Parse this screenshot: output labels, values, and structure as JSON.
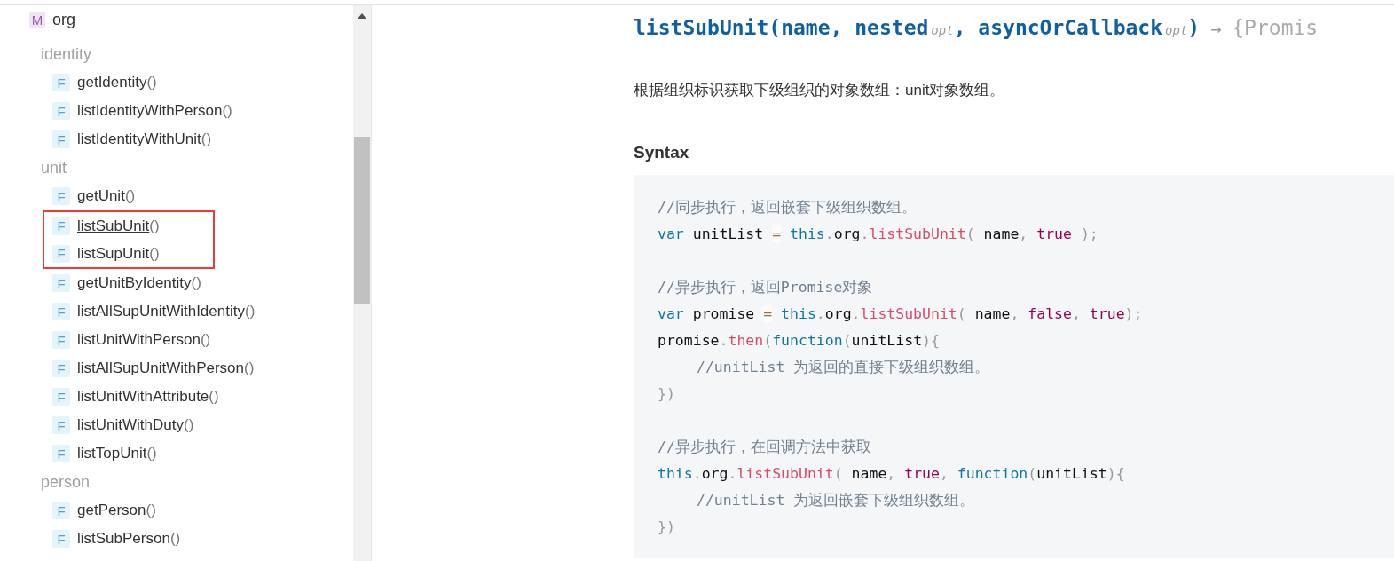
{
  "sidebar": {
    "module": {
      "badge": "M",
      "name": "org"
    },
    "groups": [
      {
        "title": "identity",
        "items": [
          {
            "badge": "F",
            "label": "getIdentity",
            "parens": "()",
            "hovered": false,
            "highlighted": false
          },
          {
            "badge": "F",
            "label": "listIdentityWithPerson",
            "parens": "()",
            "hovered": false,
            "highlighted": false
          },
          {
            "badge": "F",
            "label": "listIdentityWithUnit",
            "parens": "()",
            "hovered": false,
            "highlighted": false
          }
        ]
      },
      {
        "title": "unit",
        "items": [
          {
            "badge": "F",
            "label": "getUnit",
            "parens": "()",
            "hovered": false,
            "highlighted": false
          },
          {
            "badge": "F",
            "label": "listSubUnit",
            "parens": "()",
            "hovered": true,
            "highlighted": true
          },
          {
            "badge": "F",
            "label": "listSupUnit",
            "parens": "()",
            "hovered": false,
            "highlighted": true
          },
          {
            "badge": "F",
            "label": "getUnitByIdentity",
            "parens": "()",
            "hovered": false,
            "highlighted": false
          },
          {
            "badge": "F",
            "label": "listAllSupUnitWithIdentity",
            "parens": "()",
            "hovered": false,
            "highlighted": false
          },
          {
            "badge": "F",
            "label": "listUnitWithPerson",
            "parens": "()",
            "hovered": false,
            "highlighted": false
          },
          {
            "badge": "F",
            "label": "listAllSupUnitWithPerson",
            "parens": "()",
            "hovered": false,
            "highlighted": false
          },
          {
            "badge": "F",
            "label": "listUnitWithAttribute",
            "parens": "()",
            "hovered": false,
            "highlighted": false
          },
          {
            "badge": "F",
            "label": "listUnitWithDuty",
            "parens": "()",
            "hovered": false,
            "highlighted": false
          },
          {
            "badge": "F",
            "label": "listTopUnit",
            "parens": "()",
            "hovered": false,
            "highlighted": false
          }
        ]
      },
      {
        "title": "person",
        "items": [
          {
            "badge": "F",
            "label": "getPerson",
            "parens": "()",
            "hovered": false,
            "highlighted": false
          },
          {
            "badge": "F",
            "label": "listSubPerson",
            "parens": "()",
            "hovered": false,
            "highlighted": false
          }
        ]
      }
    ]
  },
  "doc": {
    "signature": [
      {
        "kind": "name",
        "text": "listSubUnit(name, nested"
      },
      {
        "kind": "opt",
        "text": "opt"
      },
      {
        "kind": "name",
        "text": ", asyncOrCallback"
      },
      {
        "kind": "opt",
        "text": "opt"
      },
      {
        "kind": "name",
        "text": ")"
      },
      {
        "kind": "arrow",
        "text": "→"
      },
      {
        "kind": "type",
        "text": "{Promis"
      }
    ],
    "description": "根据组织标识获取下级组织的对象数组：unit对象数组。",
    "syntax_heading": "Syntax",
    "code": [
      {
        "kind": "code",
        "indented": false,
        "tokens": [
          {
            "kind": "comment",
            "text": "//同步执行，返回嵌套下级组织数组。"
          }
        ]
      },
      {
        "kind": "code",
        "indented": false,
        "tokens": [
          {
            "kind": "keyword",
            "text": "var"
          },
          {
            "kind": "plain",
            "text": " unitList "
          },
          {
            "kind": "op",
            "text": "="
          },
          {
            "kind": "keyword",
            "text": " this"
          },
          {
            "kind": "punct",
            "text": "."
          },
          {
            "kind": "plain",
            "text": "org"
          },
          {
            "kind": "punct",
            "text": "."
          },
          {
            "kind": "fn",
            "text": "listSubUnit"
          },
          {
            "kind": "punct",
            "text": "("
          },
          {
            "kind": "plain",
            "text": " name"
          },
          {
            "kind": "punct",
            "text": ","
          },
          {
            "kind": "bool",
            "text": " true"
          },
          {
            "kind": "punct",
            "text": " );"
          }
        ]
      },
      {
        "kind": "blank"
      },
      {
        "kind": "code",
        "indented": false,
        "tokens": [
          {
            "kind": "comment",
            "text": "//异步执行，返回Promise对象"
          }
        ]
      },
      {
        "kind": "code",
        "indented": false,
        "tokens": [
          {
            "kind": "keyword",
            "text": "var"
          },
          {
            "kind": "plain",
            "text": " promise "
          },
          {
            "kind": "op",
            "text": "="
          },
          {
            "kind": "keyword",
            "text": " this"
          },
          {
            "kind": "punct",
            "text": "."
          },
          {
            "kind": "plain",
            "text": "org"
          },
          {
            "kind": "punct",
            "text": "."
          },
          {
            "kind": "fn",
            "text": "listSubUnit"
          },
          {
            "kind": "punct",
            "text": "("
          },
          {
            "kind": "plain",
            "text": " name"
          },
          {
            "kind": "punct",
            "text": ","
          },
          {
            "kind": "bool",
            "text": " false"
          },
          {
            "kind": "punct",
            "text": ","
          },
          {
            "kind": "bool",
            "text": " true"
          },
          {
            "kind": "punct",
            "text": ");"
          }
        ]
      },
      {
        "kind": "code",
        "indented": false,
        "tokens": [
          {
            "kind": "plain",
            "text": "promise"
          },
          {
            "kind": "punct",
            "text": "."
          },
          {
            "kind": "fn",
            "text": "then"
          },
          {
            "kind": "punct",
            "text": "("
          },
          {
            "kind": "keyword",
            "text": "function"
          },
          {
            "kind": "punct",
            "text": "("
          },
          {
            "kind": "plain",
            "text": "unitList"
          },
          {
            "kind": "punct",
            "text": "){"
          }
        ]
      },
      {
        "kind": "code",
        "indented": true,
        "tokens": [
          {
            "kind": "comment",
            "text": "//unitList 为返回的直接下级组织数组。"
          }
        ]
      },
      {
        "kind": "code",
        "indented": false,
        "tokens": [
          {
            "kind": "punct",
            "text": "})"
          }
        ]
      },
      {
        "kind": "blank"
      },
      {
        "kind": "code",
        "indented": false,
        "tokens": [
          {
            "kind": "comment",
            "text": "//异步执行，在回调方法中获取"
          }
        ]
      },
      {
        "kind": "code",
        "indented": false,
        "tokens": [
          {
            "kind": "keyword",
            "text": "this"
          },
          {
            "kind": "punct",
            "text": "."
          },
          {
            "kind": "plain",
            "text": "org"
          },
          {
            "kind": "punct",
            "text": "."
          },
          {
            "kind": "fn",
            "text": "listSubUnit"
          },
          {
            "kind": "punct",
            "text": "("
          },
          {
            "kind": "plain",
            "text": " name"
          },
          {
            "kind": "punct",
            "text": ","
          },
          {
            "kind": "bool",
            "text": " true"
          },
          {
            "kind": "punct",
            "text": ","
          },
          {
            "kind": "keyword",
            "text": " function"
          },
          {
            "kind": "punct",
            "text": "("
          },
          {
            "kind": "plain",
            "text": "unitList"
          },
          {
            "kind": "punct",
            "text": "){"
          }
        ]
      },
      {
        "kind": "code",
        "indented": true,
        "tokens": [
          {
            "kind": "comment",
            "text": "//unitList 为返回嵌套下级组织数组。"
          }
        ]
      },
      {
        "kind": "code",
        "indented": false,
        "tokens": [
          {
            "kind": "punct",
            "text": "})"
          }
        ]
      }
    ]
  }
}
